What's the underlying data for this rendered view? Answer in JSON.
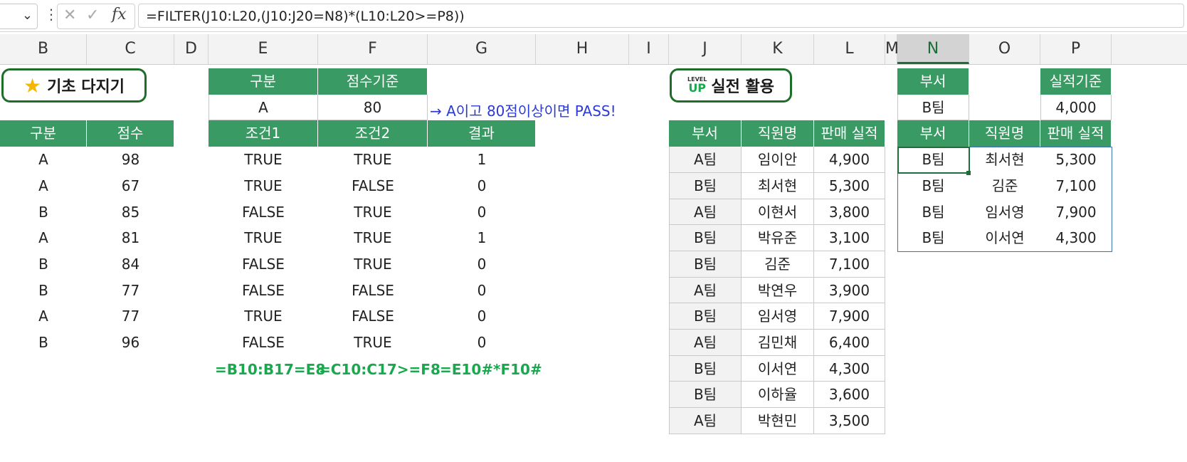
{
  "formula_bar": {
    "formula": "=FILTER(J10:L20,(J10:J20=N8)*(L10:L20>=P8))",
    "fx_label": "fx"
  },
  "columns": [
    "B",
    "C",
    "D",
    "E",
    "F",
    "G",
    "H",
    "I",
    "J",
    "K",
    "L",
    "M",
    "N",
    "O",
    "P"
  ],
  "basic_button": {
    "label": "기초 다지기",
    "icon": "star-icon"
  },
  "level_up_button": {
    "badge_top": "LEVEL",
    "badge_bottom": "UP",
    "label": "실전 활용"
  },
  "left_table": {
    "headers": [
      "구분",
      "점수"
    ],
    "rows": [
      [
        "A",
        "98"
      ],
      [
        "A",
        "67"
      ],
      [
        "B",
        "85"
      ],
      [
        "A",
        "81"
      ],
      [
        "B",
        "84"
      ],
      [
        "B",
        "77"
      ],
      [
        "A",
        "77"
      ],
      [
        "B",
        "96"
      ]
    ]
  },
  "criteria": {
    "headers": [
      "구분",
      "점수기준"
    ],
    "values": [
      "A",
      "80"
    ],
    "note": "→ A이고 80점이상이면 PASS!"
  },
  "cond_table": {
    "headers": [
      "조건1",
      "조건2",
      "결과"
    ],
    "rows": [
      [
        "TRUE",
        "TRUE",
        "1"
      ],
      [
        "TRUE",
        "FALSE",
        "0"
      ],
      [
        "FALSE",
        "TRUE",
        "0"
      ],
      [
        "TRUE",
        "TRUE",
        "1"
      ],
      [
        "FALSE",
        "TRUE",
        "0"
      ],
      [
        "FALSE",
        "FALSE",
        "0"
      ],
      [
        "TRUE",
        "FALSE",
        "0"
      ],
      [
        "FALSE",
        "TRUE",
        "0"
      ]
    ],
    "formulas": [
      "=B10:B17=E8",
      "=C10:C17>=F8",
      "=E10#*F10#"
    ]
  },
  "sales_table": {
    "headers": [
      "부서",
      "직원명",
      "판매 실적"
    ],
    "rows": [
      [
        "A팀",
        "임이안",
        "4,900"
      ],
      [
        "B팀",
        "최서현",
        "5,300"
      ],
      [
        "A팀",
        "이현서",
        "3,800"
      ],
      [
        "B팀",
        "박유준",
        "3,100"
      ],
      [
        "B팀",
        "김준",
        "7,100"
      ],
      [
        "A팀",
        "박연우",
        "3,900"
      ],
      [
        "B팀",
        "임서영",
        "7,900"
      ],
      [
        "A팀",
        "김민채",
        "6,400"
      ],
      [
        "B팀",
        "이서연",
        "4,300"
      ],
      [
        "B팀",
        "이하율",
        "3,600"
      ],
      [
        "A팀",
        "박현민",
        "3,500"
      ]
    ]
  },
  "filter_criteria": {
    "dept_header": "부서",
    "dept_value": "B팀",
    "perf_header": "실적기준",
    "perf_value": "4,000"
  },
  "result_table": {
    "headers": [
      "부서",
      "직원명",
      "판매 실적"
    ],
    "rows": [
      [
        "B팀",
        "최서현",
        "5,300"
      ],
      [
        "B팀",
        "김준",
        "7,100"
      ],
      [
        "B팀",
        "임서영",
        "7,900"
      ],
      [
        "B팀",
        "이서연",
        "4,300"
      ]
    ]
  },
  "colors": {
    "header_green": "#3a9a64",
    "accent_dark_green": "#1e6e3a",
    "note_blue": "#2b3ad6",
    "formula_green": "#19a84e"
  }
}
